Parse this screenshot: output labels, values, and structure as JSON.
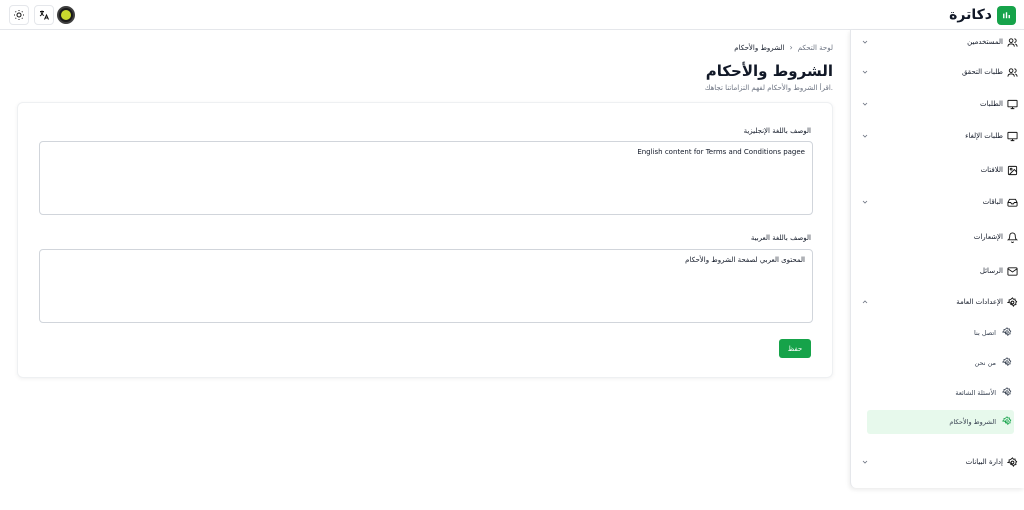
{
  "header": {
    "brand_name": "دكاترة",
    "theme_toggle_icon": "sun-icon",
    "language_icon": "translate-icon",
    "avatar_icon": "user-avatar"
  },
  "sidebar": {
    "items": [
      {
        "label": "المستخدمين",
        "icon": "users-icon",
        "has_chevron": true
      },
      {
        "label": "طلبات التحقق",
        "icon": "users-icon",
        "has_chevron": true
      },
      {
        "label": "الطلبات",
        "icon": "monitor-icon",
        "has_chevron": true
      },
      {
        "label": "طلبات الإلغاء",
        "icon": "monitor-icon",
        "has_chevron": true
      },
      {
        "label": "اللافتات",
        "icon": "image-icon",
        "has_chevron": false
      },
      {
        "label": "الباقات",
        "icon": "inbox-icon",
        "has_chevron": true
      },
      {
        "label": "الإشعارات",
        "icon": "bell-icon",
        "has_chevron": false
      },
      {
        "label": "الرسائل",
        "icon": "mail-icon",
        "has_chevron": false
      },
      {
        "label": "الإعدادات العامة",
        "icon": "gear-icon",
        "has_chevron": true,
        "expanded": true
      },
      {
        "label": "إدارة البيانات",
        "icon": "gear-icon",
        "has_chevron": true
      }
    ],
    "sub_items": [
      {
        "label": "اتصل بنا",
        "icon": "gear-icon"
      },
      {
        "label": "من نحن",
        "icon": "gear-icon"
      },
      {
        "label": "الأسئلة الشائعة",
        "icon": "gear-icon"
      },
      {
        "label": "الشروط والأحكام",
        "icon": "gear-icon",
        "active": true
      }
    ]
  },
  "breadcrumb": {
    "home": "لوحة التحكم",
    "separator": "›",
    "current": "الشروط والأحكام"
  },
  "page": {
    "title": "الشروط والأحكام",
    "subtitle": "اقرأ الشروط والأحكام لفهم التزاماتنا تجاهك."
  },
  "form": {
    "english_label": "الوصف باللغة الإنجليزية",
    "english_value": "English content for Terms and Conditions pagee",
    "arabic_label": "الوصف باللغة العربية",
    "arabic_value": "المحتوى العربي لصفحة الشروط والأحكام",
    "save_label": "حفظ"
  },
  "colors": {
    "accent": "#16a34a",
    "active_bg": "#e7f9ec"
  }
}
